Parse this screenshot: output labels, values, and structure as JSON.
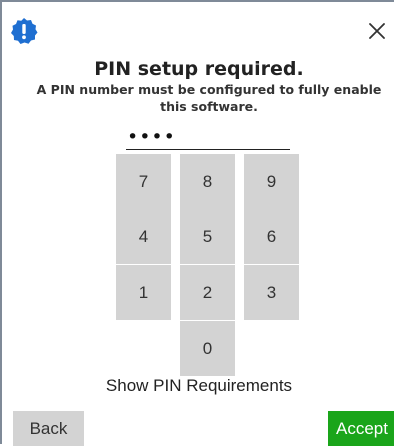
{
  "colors": {
    "accent_green": "#1aa51a",
    "badge_blue": "#1f6fd1",
    "key_gray": "#d3d3d3"
  },
  "header": {
    "badge_icon": "exclamation-badge-icon",
    "close_icon": "close-icon",
    "title": "PIN setup required.",
    "description": "A PIN number must be configured to fully enable this software."
  },
  "pin": {
    "value": "••••"
  },
  "keypad": {
    "keys": [
      "7",
      "8",
      "9",
      "4",
      "5",
      "6",
      "1",
      "2",
      "3",
      "0"
    ]
  },
  "footer": {
    "show_requirements": "Show PIN Requirements",
    "back_label": "Back",
    "accept_label": "Accept"
  }
}
